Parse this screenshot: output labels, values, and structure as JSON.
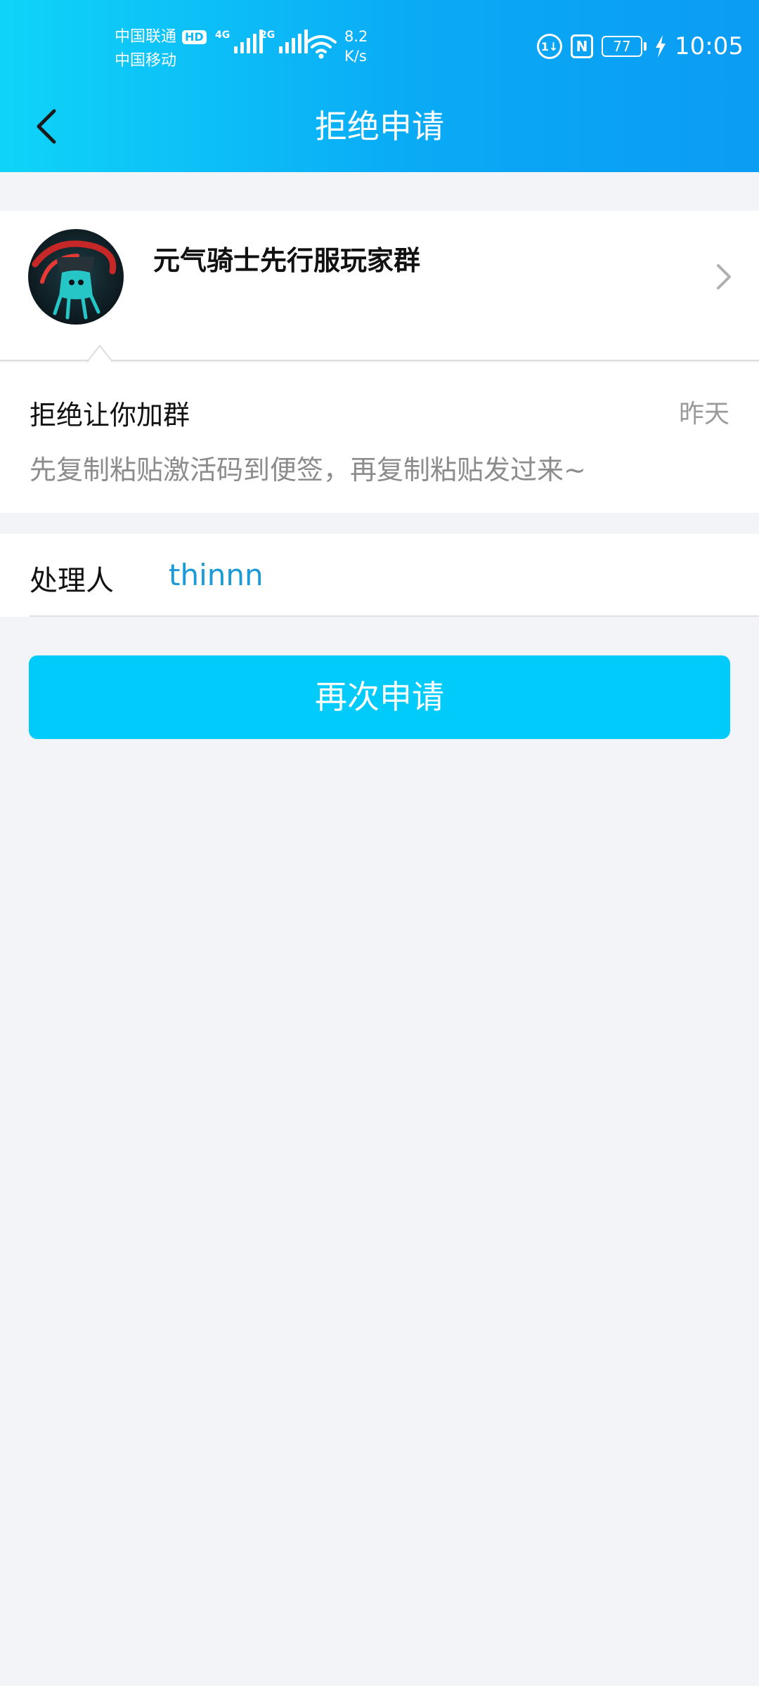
{
  "status_bar": {
    "carrier_1": "中国联通",
    "hd_badge": "HD",
    "carrier_2": "中国移动",
    "network_1": "4G",
    "network_2": "2G",
    "speed_value": "8.2",
    "speed_unit": "K/s",
    "data_saver_icon_text": "1↓",
    "nfc_icon_text": "N",
    "battery_level": "77",
    "time": "10:05"
  },
  "header": {
    "title": "拒绝申请"
  },
  "group": {
    "name": "元气骑士先行服玩家群"
  },
  "rejection": {
    "title": "拒绝让你加群",
    "time": "昨天",
    "reason": "先复制粘贴激活码到便签，再复制粘贴发过来~"
  },
  "handler": {
    "label": "处理人",
    "name": "thinnn"
  },
  "actions": {
    "reapply_label": "再次申请"
  },
  "colors": {
    "header_gradient_start": "#0fd4f9",
    "header_gradient_end": "#0b9cf4",
    "button": "#00cbfb",
    "handler_link": "#1b9ad7",
    "background": "#f3f4f8"
  }
}
